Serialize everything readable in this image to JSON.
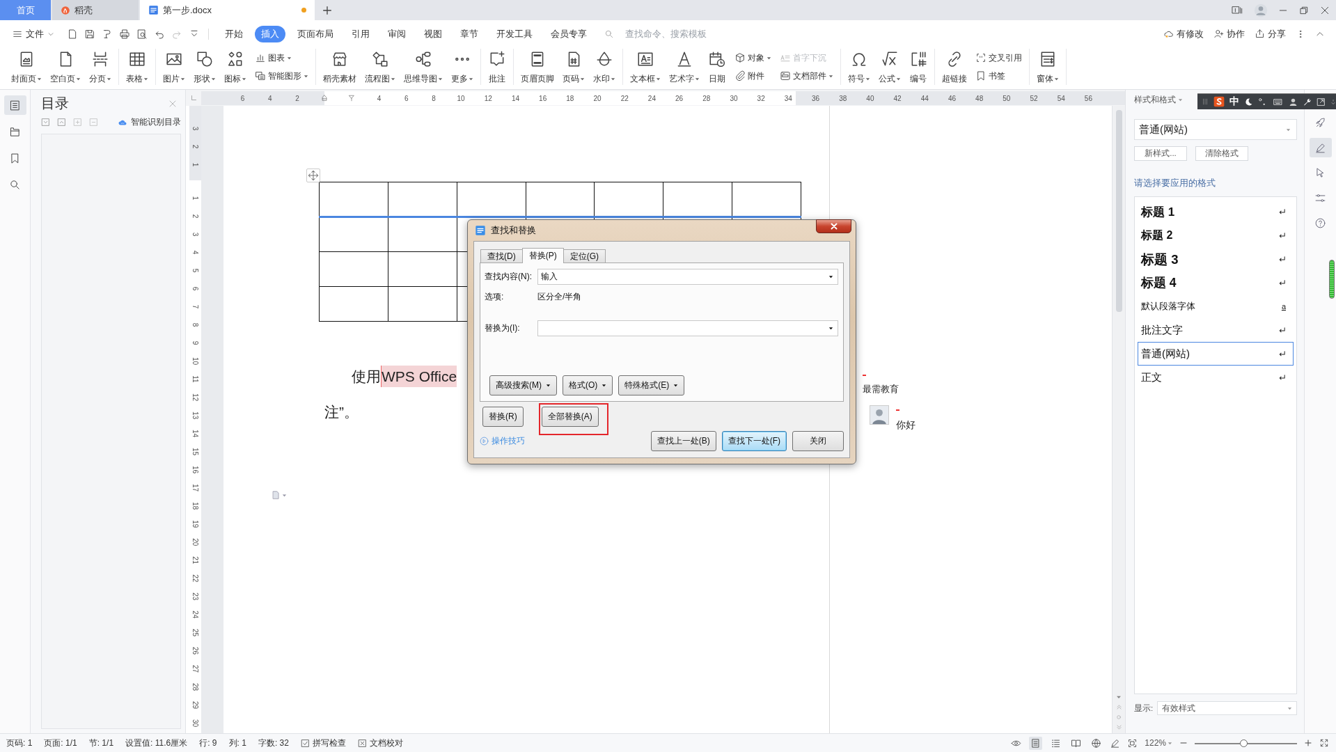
{
  "tab_bar": {
    "tabs": [
      {
        "label": "首页",
        "kind": "home",
        "selected": false,
        "modified": false
      },
      {
        "label": "稻壳",
        "kind": "app",
        "selected": false,
        "modified": false
      },
      {
        "label": "第一步.docx",
        "kind": "doc",
        "selected": true,
        "modified": true
      }
    ]
  },
  "menu_bar": {
    "file_menu": "文件",
    "tabs": [
      {
        "label": "开始",
        "selected": false
      },
      {
        "label": "插入",
        "selected": true
      },
      {
        "label": "页面布局",
        "selected": false
      },
      {
        "label": "引用",
        "selected": false
      },
      {
        "label": "审阅",
        "selected": false
      },
      {
        "label": "视图",
        "selected": false
      },
      {
        "label": "章节",
        "selected": false
      },
      {
        "label": "开发工具",
        "selected": false
      },
      {
        "label": "会员专享",
        "selected": false
      }
    ],
    "search": {
      "placeholder": "查找命令、搜索模板"
    },
    "actions": [
      {
        "label": "有修改"
      },
      {
        "label": "协作"
      },
      {
        "label": "分享"
      }
    ]
  },
  "ribbon": {
    "groups": [
      {
        "items": [
          {
            "kind": "large",
            "label": "封面页",
            "dropdown": true
          },
          {
            "kind": "large",
            "label": "空白页",
            "dropdown": true
          },
          {
            "kind": "large",
            "label": "分页",
            "dropdown": true
          }
        ]
      },
      {
        "items": [
          {
            "kind": "large",
            "label": "表格",
            "dropdown": true
          }
        ]
      },
      {
        "items": [
          {
            "kind": "large",
            "label": "图片",
            "dropdown": true
          },
          {
            "kind": "large",
            "label": "形状",
            "dropdown": true
          },
          {
            "kind": "large",
            "label": "图标",
            "dropdown": true
          },
          {
            "kind": "stack",
            "items": [
              {
                "label": "图表",
                "dropdown": true,
                "disabled": false
              },
              {
                "label": "智能图形",
                "dropdown": true,
                "disabled": false
              }
            ]
          }
        ]
      },
      {
        "items": [
          {
            "kind": "large",
            "label": "稻壳素材",
            "dropdown": false
          },
          {
            "kind": "large",
            "label": "流程图",
            "dropdown": true
          },
          {
            "kind": "large",
            "label": "思维导图",
            "dropdown": true
          },
          {
            "kind": "large",
            "label": "更多",
            "dropdown": true
          }
        ]
      },
      {
        "items": [
          {
            "kind": "large",
            "label": "批注",
            "dropdown": false
          }
        ]
      },
      {
        "items": [
          {
            "kind": "large",
            "label": "页眉页脚",
            "dropdown": false
          },
          {
            "kind": "large",
            "label": "页码",
            "dropdown": true
          },
          {
            "kind": "large",
            "label": "水印",
            "dropdown": true
          }
        ]
      },
      {
        "items": [
          {
            "kind": "large",
            "label": "文本框",
            "dropdown": true
          },
          {
            "kind": "large",
            "label": "艺术字",
            "dropdown": true
          },
          {
            "kind": "large",
            "label": "日期",
            "dropdown": false
          },
          {
            "kind": "stack",
            "items": [
              {
                "label": "对象",
                "dropdown": true,
                "disabled": false
              },
              {
                "label": "附件",
                "dropdown": false,
                "disabled": false
              }
            ]
          },
          {
            "kind": "stack",
            "items": [
              {
                "label": "首字下沉",
                "dropdown": false,
                "disabled": true
              },
              {
                "label": "文档部件",
                "dropdown": true,
                "disabled": false
              }
            ]
          }
        ]
      },
      {
        "items": [
          {
            "kind": "large",
            "label": "符号",
            "dropdown": true
          },
          {
            "kind": "large",
            "label": "公式",
            "dropdown": true
          },
          {
            "kind": "large",
            "label": "编号",
            "dropdown": false
          }
        ]
      },
      {
        "items": [
          {
            "kind": "large",
            "label": "超链接",
            "dropdown": false
          },
          {
            "kind": "stack",
            "items": [
              {
                "label": "交叉引用",
                "dropdown": false,
                "disabled": false
              },
              {
                "label": "书签",
                "dropdown": false,
                "disabled": false
              }
            ]
          }
        ]
      },
      {
        "items": [
          {
            "kind": "large",
            "label": "窗体",
            "dropdown": true
          }
        ]
      }
    ]
  },
  "left_toolbar": {
    "items": [
      {
        "selected": true
      },
      {
        "selected": false
      },
      {
        "selected": false
      },
      {
        "selected": false
      }
    ]
  },
  "nav_pane": {
    "title": "目录",
    "smart_toc": "智能识别目录"
  },
  "ruler": {
    "left_numbers": [
      "6",
      "4",
      "2"
    ],
    "right_numbers": [
      "4",
      "6",
      "8",
      "10",
      "12",
      "14",
      "16",
      "18",
      "20",
      "22",
      "24",
      "26",
      "28",
      "30",
      "32",
      "34",
      "36",
      "38",
      "40",
      "42",
      "44",
      "46",
      "48",
      "50",
      "52",
      "54",
      "56"
    ]
  },
  "vertical_ruler": {
    "top_numbers": [
      "3",
      "2",
      "1"
    ],
    "numbers": [
      "1",
      "2",
      "3",
      "4",
      "5",
      "6",
      "7",
      "8",
      "9",
      "10",
      "11",
      "12",
      "13",
      "14",
      "15",
      "16",
      "17",
      "18",
      "19",
      "20",
      "21",
      "22",
      "23",
      "24",
      "25",
      "26",
      "27",
      "28",
      "29",
      "30"
    ]
  },
  "document": {
    "paragraphs": [
      {
        "segments": [
          {
            "text": "使用",
            "highlighted": false
          },
          {
            "text": "WPS Office",
            "highlighted": true
          }
        ]
      },
      {
        "segments": [
          {
            "text": "注”。",
            "highlighted": false
          }
        ]
      }
    ]
  },
  "comment": {
    "author": "最需教育",
    "replies": [
      {
        "text": "你好"
      }
    ]
  },
  "dialog": {
    "title": "查找和替换",
    "tabs": [
      {
        "label": "查找(D)",
        "selected": false
      },
      {
        "label": "替换(P)",
        "selected": true
      },
      {
        "label": "定位(G)",
        "selected": false
      }
    ],
    "find": {
      "label": "查找内容(N):",
      "value": "输入"
    },
    "options": {
      "label": "选项:",
      "value": "区分全/半角"
    },
    "replace": {
      "label": "替换为(I):"
    },
    "option_buttons": [
      {
        "label": "高级搜索(M)"
      },
      {
        "label": "格式(O)"
      },
      {
        "label": "特殊格式(E)"
      }
    ],
    "actions": [
      {
        "label": "替换(R)",
        "highlighted": false
      },
      {
        "label": "全部替换(A)",
        "highlighted": true
      }
    ],
    "tips_link": "操作技巧",
    "nav_buttons": [
      {
        "label": "查找上一处(B)",
        "default": false
      },
      {
        "label": "查找下一处(F)",
        "default": true
      },
      {
        "label": "关闭",
        "default": false
      }
    ]
  },
  "ime_bar": {
    "mode": "中"
  },
  "styles_panel": {
    "title": "样式和格式",
    "current": "普通(网站)",
    "buttons": [
      "新样式...",
      "清除格式"
    ],
    "prompt": "请选择要应用的格式",
    "styles": [
      {
        "label": "标题 1",
        "kind": "heading1",
        "selected": false
      },
      {
        "label": "标题 2",
        "kind": "heading2",
        "selected": false
      },
      {
        "label": "标题 3",
        "kind": "heading3",
        "selected": false
      },
      {
        "label": "标题 4",
        "kind": "heading4",
        "selected": false
      },
      {
        "label": "默认段落字体",
        "kind": "character",
        "mark": "a",
        "selected": false
      },
      {
        "label": "批注文字",
        "kind": "paragraph",
        "selected": false
      },
      {
        "label": "普通(网站)",
        "kind": "paragraph",
        "selected": true
      },
      {
        "label": "正文",
        "kind": "paragraph",
        "selected": false
      }
    ],
    "show_label": "显示:",
    "show_value": "有效样式"
  },
  "right_toolbar": {
    "items": [
      {
        "selected": false
      },
      {
        "selected": true
      },
      {
        "selected": false
      },
      {
        "selected": false
      },
      {
        "selected": false
      }
    ]
  },
  "status_bar": {
    "items": [
      "页码: 1",
      "页面: 1/1",
      "节: 1/1",
      "设置值: 11.6厘米",
      "行: 9",
      "列: 1",
      "字数: 32"
    ],
    "spell_check": {
      "label": "拼写检查",
      "checked": true
    },
    "proofread": {
      "label": "文档校对"
    },
    "views": [
      {
        "selected": true
      },
      {
        "selected": false
      },
      {
        "selected": false
      },
      {
        "selected": false
      }
    ],
    "zoom": "122%",
    "zoom_slider": {
      "level": 0.48
    }
  }
}
